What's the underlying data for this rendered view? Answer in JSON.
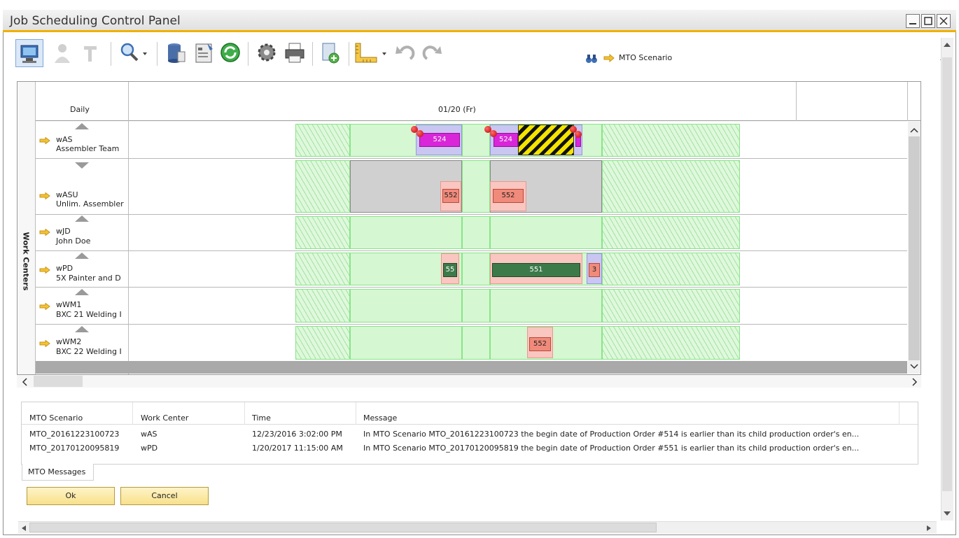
{
  "window": {
    "title": "Job Scheduling Control Panel"
  },
  "toolbar": {
    "icons": [
      "monitor-icon",
      "user-icon",
      "tool-icon",
      "magnifier-icon",
      "database-icon",
      "report-icon",
      "refresh-icon",
      "gear-icon",
      "printer-icon",
      "export-icon",
      "ruler-icon",
      "undo-icon",
      "redo-icon"
    ],
    "find_icon": "binoculars-icon",
    "scenario_label": "MTO Scenario",
    "scenario_value": ""
  },
  "gantt": {
    "vertical_label": "Work Centers",
    "header_left": "Daily",
    "header_date": "01/20 (Fr)",
    "rows": [
      {
        "code": "wAS",
        "name": "Assembler Team"
      },
      {
        "code": "wASU",
        "name": "Unlim. Assembler"
      },
      {
        "code": "wJD",
        "name": "John Doe"
      },
      {
        "code": "wPD",
        "name": "5X Painter and D"
      },
      {
        "code": "wWM1",
        "name": "BXC 21 Welding I"
      },
      {
        "code": "wWM2",
        "name": "BXC 22 Welding I"
      }
    ],
    "bars": {
      "was_a": "524",
      "was_b": "524",
      "wasu_a": "552",
      "wasu_b": "552",
      "wpd_a": "55",
      "wpd_b": "551",
      "wpd_c": "3",
      "wwm2_a": "552"
    },
    "colors": {
      "accent": "#f0b000",
      "magenta": "#d826d8",
      "salmon": "#f08a7a",
      "darkgreen": "#3c7a4a",
      "band": "#d5f7d2"
    }
  },
  "messages": {
    "headers": [
      "MTO Scenario",
      "Work Center",
      "Time",
      "Message"
    ],
    "rows": [
      [
        "MTO_20161223100723",
        "wAS",
        "12/23/2016 3:02:00 PM",
        "In MTO Scenario MTO_20161223100723 the begin date of Production Order #514 is earlier than its child production order's en..."
      ],
      [
        "MTO_20170120095819",
        "wPD",
        "1/20/2017 11:15:00 AM",
        "In MTO Scenario MTO_20170120095819 the begin date of Production Order #551 is earlier than its child production order's en..."
      ]
    ],
    "tab": "MTO Messages"
  },
  "buttons": {
    "ok": "Ok",
    "cancel": "Cancel"
  }
}
